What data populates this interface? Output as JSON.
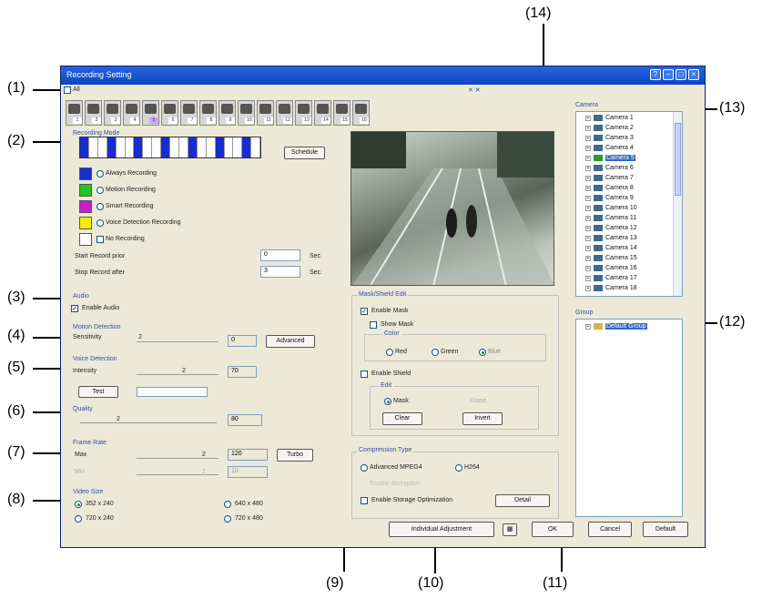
{
  "callouts": [
    "(1)",
    "(2)",
    "(3)",
    "(4)",
    "(5)",
    "(6)",
    "(7)",
    "(8)",
    "(9)",
    "(10)",
    "(11)",
    "(12)",
    "(13)",
    "(14)"
  ],
  "window": {
    "title": "Recording Setting"
  },
  "top": {
    "all_label": "All",
    "cam_numbers": [
      "1",
      "2",
      "3",
      "4",
      "5",
      "6",
      "7",
      "8",
      "9",
      "10",
      "11",
      "12",
      "13",
      "14",
      "15",
      "16"
    ],
    "selected_cam": "5"
  },
  "recording_mode": {
    "title": "Recording Mode",
    "schedule_button": "Schedule",
    "modes": [
      "Always Recording",
      "Motion Recording",
      "Smart Recording",
      "Voice Detection Recording",
      "No Recording"
    ],
    "colors": {
      "always": "#1a2bd0",
      "motion": "#1ec81e",
      "smart": "#c81ec8",
      "voice": "#f0f000",
      "none": "#ffffff"
    },
    "start_label": "Start Record prior",
    "start_value": "0",
    "start_unit": "Sec.",
    "stop_label": "Stop Record after",
    "stop_value": "3",
    "stop_unit": "Sec."
  },
  "audio": {
    "title": "Audio",
    "enable_label": "Enable Audio",
    "enabled": "✓"
  },
  "motion": {
    "title": "Motion Detection",
    "sensitivity_label": "Sensitivity",
    "slider_value": "2",
    "field_value": "0",
    "advanced_button": "Advanced"
  },
  "voice": {
    "title": "Voice Detection",
    "intensity_label": "Intensity",
    "slider_value": "2",
    "field_value": "70",
    "test_button": "Test"
  },
  "quality": {
    "title": "Quality",
    "slider_value": "2",
    "field_value": "80"
  },
  "frame_rate": {
    "title": "Frame Rate",
    "max_label": "Max",
    "max_slider": "2",
    "max_value": "120",
    "turbo_button": "Turbo",
    "min_label": "Min",
    "min_slider": "2",
    "min_value": "10"
  },
  "video_size": {
    "title": "Video Size",
    "options": [
      "352 x 240",
      "640 x 480",
      "720 x 240",
      "720 x 480"
    ]
  },
  "mask": {
    "title": "Mask/Shield Edit",
    "enable_mask": "Enable Mask",
    "show_mask": "Show Mask",
    "color_title": "Color",
    "colors": [
      "Red",
      "Green",
      "Blue"
    ],
    "enable_shield": "Enable Shield",
    "edit_title": "Edit",
    "edit_options": [
      "Mask",
      "Erase"
    ],
    "clear_button": "Clear",
    "invert_button": "Invert"
  },
  "compression": {
    "title": "Compression Type",
    "options": [
      "Advanced MPEG4",
      "H264"
    ],
    "disabled_label": "Enable decryption",
    "storage_label": "Enable Storage Optimization",
    "detail_button": "Detail"
  },
  "camera_panel": {
    "title": "Camera",
    "items": [
      "Camera 1",
      "Camera 2",
      "Camera 3",
      "Camera 4",
      "Camera 5",
      "Camera 6",
      "Camera 7",
      "Camera 8",
      "Camera 9",
      "Camera 10",
      "Camera 11",
      "Camera 12",
      "Camera 13",
      "Camera 14",
      "Camera 15",
      "Camera 16",
      "Camera 17",
      "Camera 18"
    ],
    "selected": "Camera 5"
  },
  "group_panel": {
    "title": "Group",
    "items": [
      "Default Group"
    ]
  },
  "footer": {
    "individual_button": "Individual Adjustment",
    "ok_button": "OK",
    "cancel_button": "Cancel",
    "default_button": "Default"
  }
}
